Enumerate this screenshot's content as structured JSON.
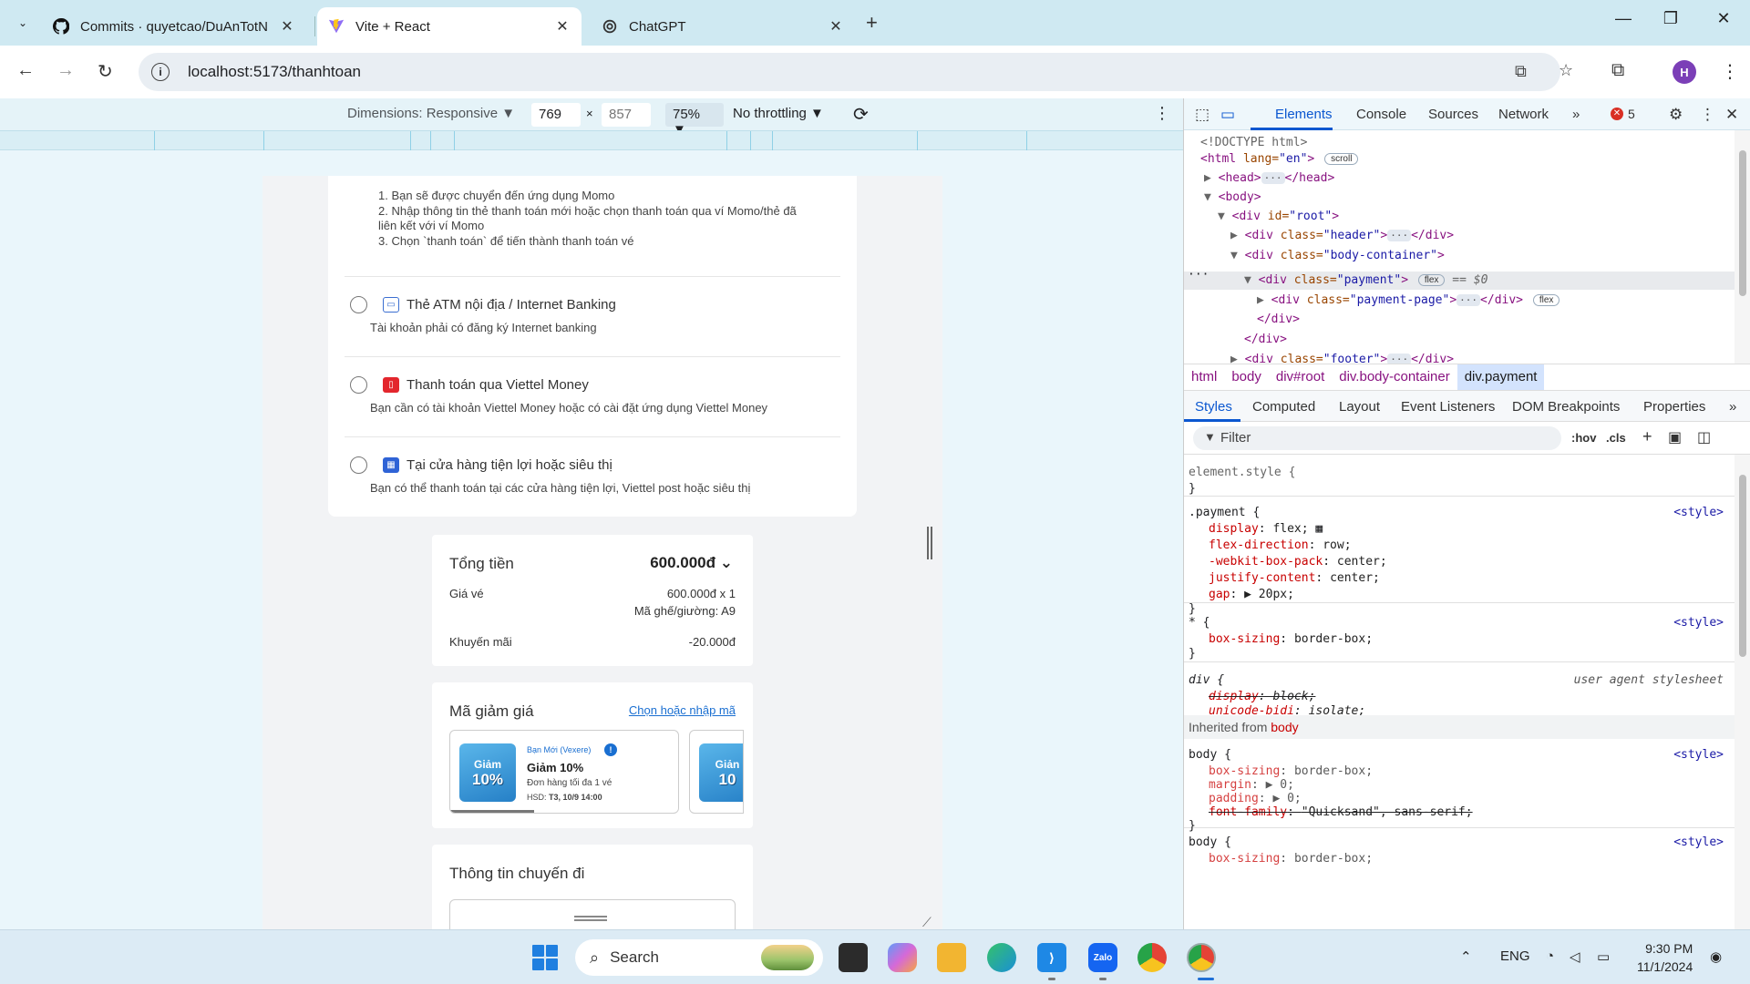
{
  "browser": {
    "tabs": [
      {
        "title": "Commits · quyetcao/DuAnTotN",
        "icon": "github-icon"
      },
      {
        "title": "Vite + React",
        "icon": "vite-icon"
      },
      {
        "title": "ChatGPT",
        "icon": "chatgpt-icon"
      }
    ],
    "url": "localhost:5173/thanhtoan",
    "profile_initial": "H"
  },
  "device_toolbar": {
    "dimensions_label": "Dimensions: Responsive ▼",
    "width": "769",
    "height": "857",
    "zoom": "75% ▼",
    "throttling": "No throttling ▼"
  },
  "payment_page": {
    "momo_steps": [
      "1. Bạn sẽ được chuyển đến ứng dụng Momo",
      "2. Nhập thông tin thẻ thanh toán mới hoặc chọn thanh toán qua ví Momo/thẻ đã",
      "liên kết với ví Momo",
      "3. Chọn `thanh toán` để tiến thành thanh toán vé"
    ],
    "methods": [
      {
        "title": "Thẻ ATM nội địa / Internet Banking",
        "desc": "Tài khoản phải có đăng ký Internet banking",
        "color": "#3b6fd1",
        "icon": "atm-card-icon"
      },
      {
        "title": "Thanh toán qua Viettel Money",
        "desc": "Bạn cần có tài khoản Viettel Money hoặc có cài đặt ứng dụng Viettel Money",
        "color": "#e3262d",
        "icon": "viettel-money-icon"
      },
      {
        "title": "Tại cửa hàng tiện lợi hoặc siêu thị",
        "desc": "Bạn có thể thanh toán tại các cửa hàng tiện lợi, Viettel post hoặc siêu thị",
        "color": "#2f63d6",
        "icon": "store-icon"
      }
    ],
    "summary": {
      "title": "Tổng tiền",
      "total": "600.000đ ⌄",
      "ticket_label": "Giá vé",
      "ticket_value": "600.000đ x 1",
      "seat": "Mã ghế/giường: A9",
      "promo_label": "Khuyến mãi",
      "promo_value": "-20.000đ"
    },
    "coupon": {
      "title": "Mã giảm giá",
      "link": "Chọn hoặc nhập mã",
      "badge": "Bạn Mới (Vexere)",
      "img_top": "Giảm",
      "img_big": "10%",
      "name": "Giảm 10%",
      "desc": "Đơn hàng tối đa 1 vé",
      "expiry_label": "HSD:",
      "expiry_value": "T3, 10/9 14:00",
      "img2_top": "Giản",
      "img2_big": "10"
    },
    "trip_title": "Thông tin chuyến đi"
  },
  "devtools": {
    "tabs": [
      "Elements",
      "Console",
      "Sources",
      "Network"
    ],
    "more": "»",
    "error_count": "5",
    "dom": {
      "doctype": "<!DOCTYPE html>",
      "html_open": "<html",
      "html_attr": " lang=",
      "html_val": "\"en\"",
      "html_close": ">",
      "scroll_pill": "scroll",
      "head_open": "<head>",
      "head_close": "</head>",
      "body_open": "<body>",
      "div_open": "<div",
      "id_attr": " id=",
      "root_val": "\"root\"",
      "class_attr": " class=",
      "header_val": "\"header\"",
      "body_container_val": "\"body-container\"",
      "payment_val": "\"payment\"",
      "payment_page_val": "\"payment-page\"",
      "footer_val": "\"footer\"",
      "gt": ">",
      "div_close": "</div>",
      "flex_pill": "flex",
      "dollar0": " == $0",
      "ellipsis": "···",
      "row_dots": "···"
    },
    "breadcrumbs": [
      "html",
      "body",
      "div#root",
      "div.body-container",
      "div.payment"
    ],
    "sub_tabs": [
      "Styles",
      "Computed",
      "Layout",
      "Event Listeners",
      "DOM Breakpoints",
      "Properties"
    ],
    "sub_more": "»",
    "filter_placeholder": "Filter",
    "hov": ":hov",
    "cls": ".cls",
    "styles": {
      "element_style": "element.style {",
      "close": "}",
      "payment_sel": ".payment {",
      "style_src": "<style>",
      "ua_src": "user agent stylesheet",
      "props_payment": [
        {
          "name": "display",
          "value": "flex;"
        },
        {
          "name": "flex-direction",
          "value": "row;"
        },
        {
          "name": "-webkit-box-pack",
          "value": "center;"
        },
        {
          "name": "justify-content",
          "value": "center;"
        },
        {
          "name": "gap",
          "value": "▶ 20px;"
        }
      ],
      "star_sel": "* {",
      "star_prop": {
        "name": "box-sizing",
        "value": "border-box;"
      },
      "div_sel": "div {",
      "div_props": [
        {
          "name": "display",
          "value": "block;"
        },
        {
          "name": "unicode-bidi",
          "value": "isolate;"
        }
      ],
      "inherited_label": "Inherited from",
      "inherited_from": "body",
      "body_sel": "body {",
      "body_props": [
        {
          "name": "box-sizing",
          "value": "border-box;"
        },
        {
          "name": "margin",
          "value": "▶ 0;"
        },
        {
          "name": "padding",
          "value": "▶ 0;"
        },
        {
          "name": "font-family",
          "value": "\"Quicksand\", sans-serif;"
        }
      ],
      "body2_prop": {
        "name": "box-sizing",
        "value": "border-box;"
      }
    }
  },
  "taskbar": {
    "search_label": "Search",
    "language": "ENG",
    "time": "9:30 PM",
    "date": "11/1/2024",
    "apps": [
      {
        "name": "task-view-icon",
        "color": "#2b2b2b",
        "label": ""
      },
      {
        "name": "copilot-icon",
        "color": "#6b7bef",
        "label": ""
      },
      {
        "name": "file-explorer-icon",
        "color": "#f2b531",
        "label": ""
      },
      {
        "name": "edge-icon",
        "color": "#1a8fd6",
        "label": ""
      },
      {
        "name": "vscode-icon",
        "color": "#1e88e5",
        "label": ""
      },
      {
        "name": "zalo-icon",
        "color": "#1565f1",
        "label": "Zalo"
      },
      {
        "name": "chrome-icon",
        "color": "#e54336",
        "label": ""
      },
      {
        "name": "chrome-profile-icon",
        "color": "#d93b2f",
        "label": ""
      }
    ]
  }
}
